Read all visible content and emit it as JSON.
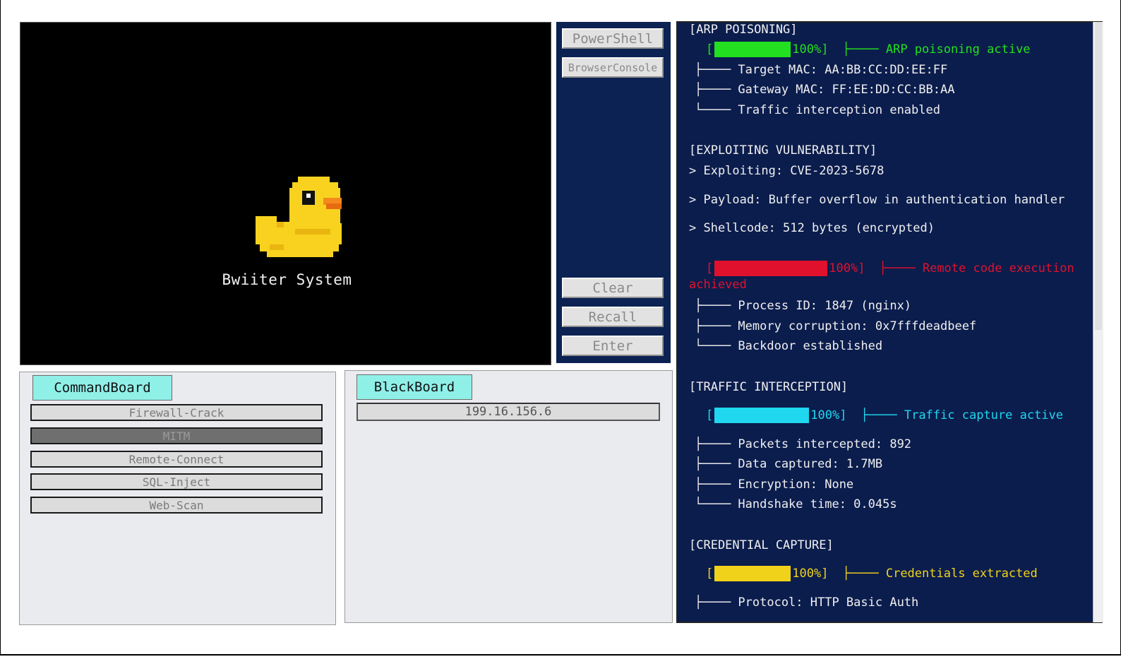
{
  "game": {
    "title": "Bwiiter System"
  },
  "side_buttons": {
    "powershell": "PowerShell",
    "browser_console": "BrowserConsole",
    "clear": "Clear",
    "recall": "Recall",
    "enter": "Enter"
  },
  "command_board": {
    "tab": "CommandBoard",
    "items": [
      "Firewall-Crack",
      "MITM",
      "Remote-Connect",
      "SQL-Inject",
      "Web-Scan"
    ],
    "active_item": "MITM"
  },
  "black_board": {
    "tab": "BlackBoard",
    "ip": "199.16.156.6"
  },
  "log": {
    "arp": {
      "header": "[ARP POISONING]",
      "bar_open": "[",
      "bar_pct": "100%]",
      "bar_progress": 1.0,
      "bar_msg": "├──── ARP poisoning active",
      "color": "#22e01f",
      "lines": [
        "├──── Target MAC: AA:BB:CC:DD:EE:FF",
        "├──── Gateway MAC: FF:EE:DD:CC:BB:AA",
        "└──── Traffic interception enabled"
      ]
    },
    "exploit": {
      "header": "[EXPLOITING VULNERABILITY]",
      "lines": [
        "> Exploiting: CVE-2023-5678",
        "> Payload: Buffer overflow in authentication handler",
        "> Shellcode: 512 bytes (encrypted)"
      ],
      "bar_open": "[",
      "bar_pct": "100%]",
      "bar_progress": 1.0,
      "bar_msg": "├──── Remote code execution",
      "bar_msg_wrap": "achieved",
      "color": "#e0112d",
      "sublines": [
        "├──── Process ID: 1847 (nginx)",
        "├──── Memory corruption: 0x7fffdeadbeef",
        "└──── Backdoor established"
      ]
    },
    "traffic": {
      "header": "[TRAFFIC INTERCEPTION]",
      "bar_open": "[",
      "bar_pct": "100%]",
      "bar_progress": 1.0,
      "bar_msg": "├──── Traffic capture active",
      "color": "#1fd7ef",
      "lines": [
        "├──── Packets intercepted: 892",
        "├──── Data captured: 1.7MB",
        "├──── Encryption: None",
        "└──── Handshake time: 0.045s"
      ]
    },
    "credential": {
      "header": "[CREDENTIAL CAPTURE]",
      "bar_open": "[",
      "bar_pct": "100%]",
      "bar_progress": 1.0,
      "bar_msg": "├──── Credentials extracted",
      "color": "#f0d21a",
      "lines": [
        "├──── Protocol: HTTP Basic Auth"
      ]
    }
  }
}
